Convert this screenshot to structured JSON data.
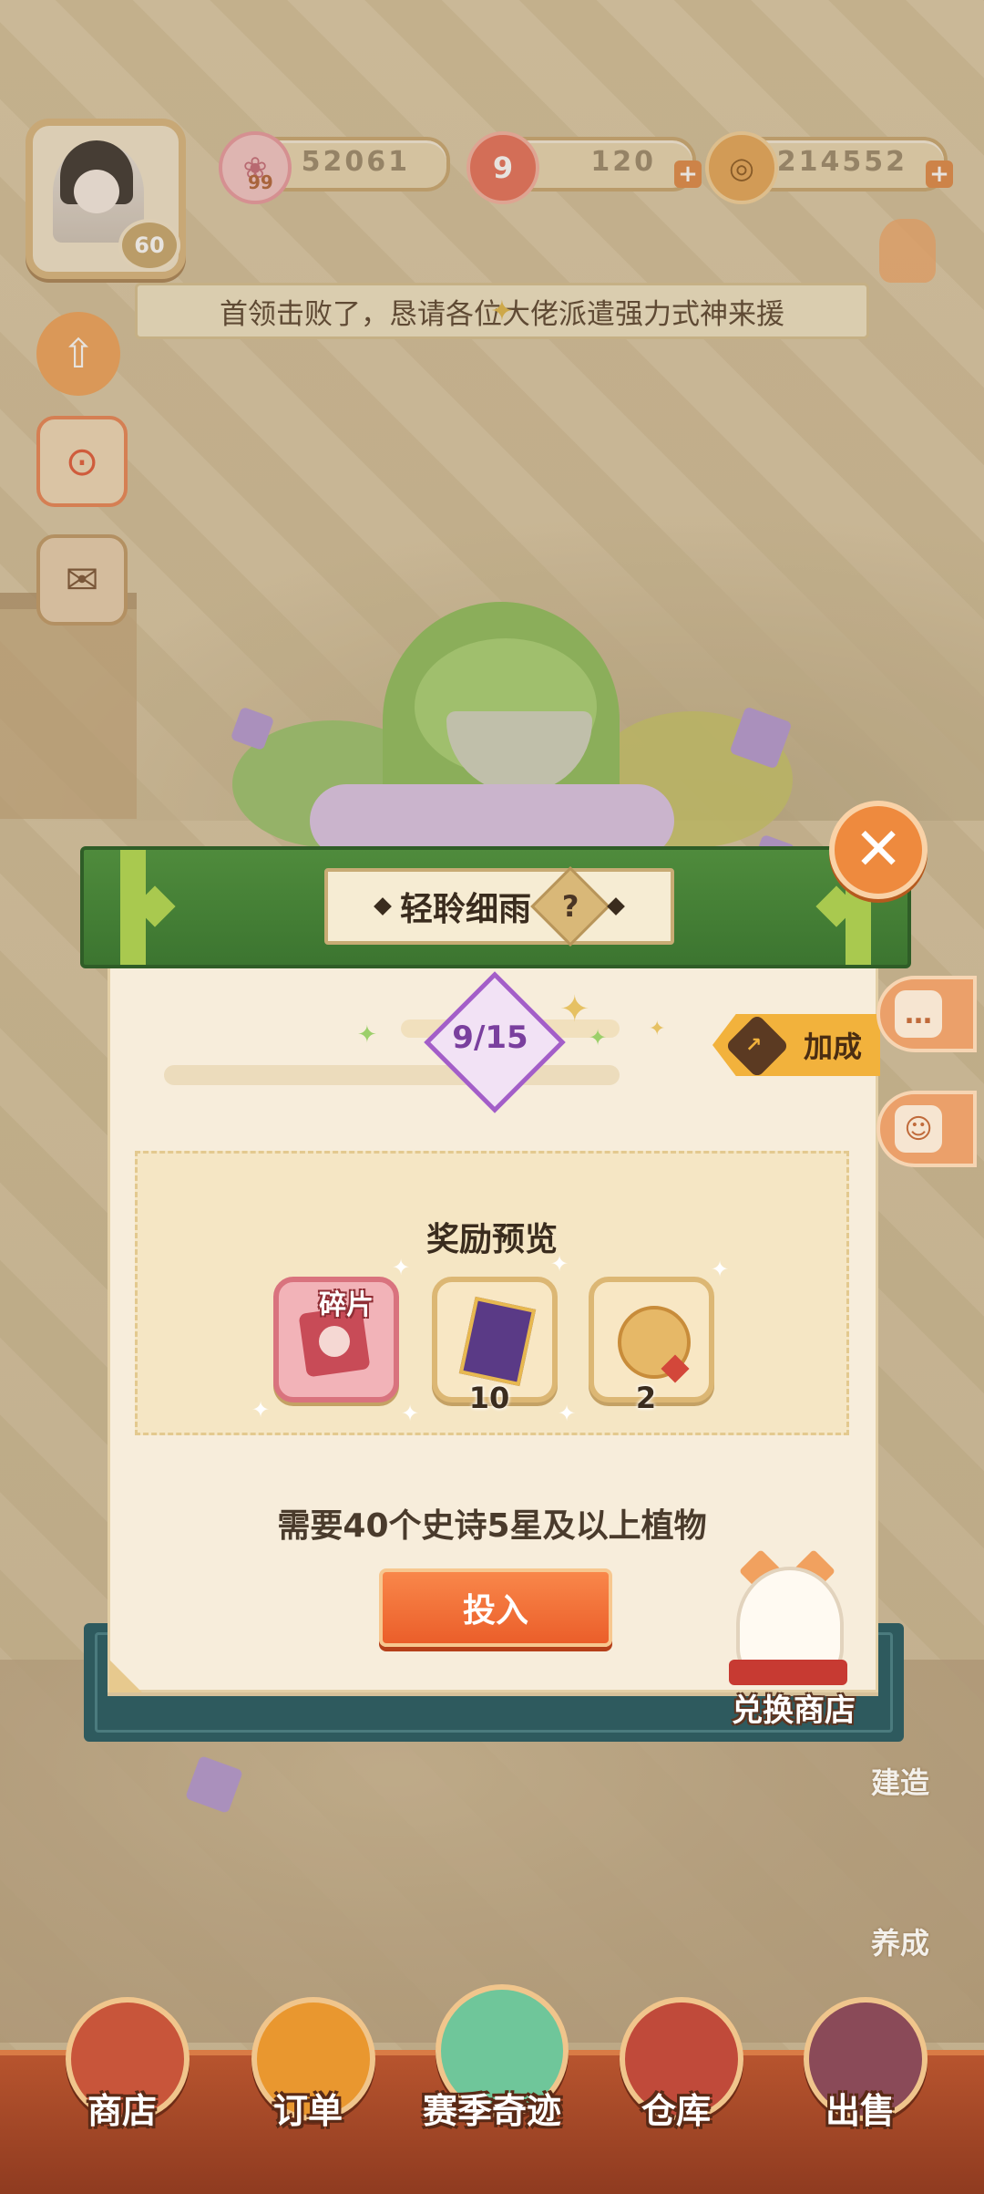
{
  "resources": {
    "sakura": "52061",
    "sakura_level": "99",
    "magatama": "120",
    "coins": "214552",
    "plus": "+"
  },
  "player": {
    "level": "60"
  },
  "notice": "首领击败了，恳请各位大佬派遣强力式神来援",
  "modal": {
    "title": "轻聆细雨",
    "help": "?",
    "close": "✕",
    "progress_text": "9/15",
    "progress": {
      "current": 9,
      "total": 15
    },
    "bonus_label": "加成",
    "reward_title": "奖励预览",
    "rewards": [
      {
        "name": "fragment",
        "label": "碎片",
        "count": ""
      },
      {
        "name": "outfit-ticket",
        "label": "",
        "count": "10"
      },
      {
        "name": "fan-charm",
        "label": "",
        "count": "2"
      }
    ],
    "requirement": "需要40个史诗5星及以上植物",
    "submit": "投入",
    "shop_label": "兑换商店"
  },
  "right_labels": {
    "build": "建造",
    "nurture": "养成"
  },
  "bottom_nav": [
    {
      "label": "商店"
    },
    {
      "label": "订单"
    },
    {
      "label": "赛季奇迹"
    },
    {
      "label": "仓库"
    },
    {
      "label": "出售"
    }
  ],
  "colors": {
    "header_green": "#3c7530",
    "accent_orange": "#eb5e2a",
    "progress_purple": "#a35ec8",
    "bonus_gold": "#f2b23c",
    "nav_brown": "#8f3b20"
  }
}
